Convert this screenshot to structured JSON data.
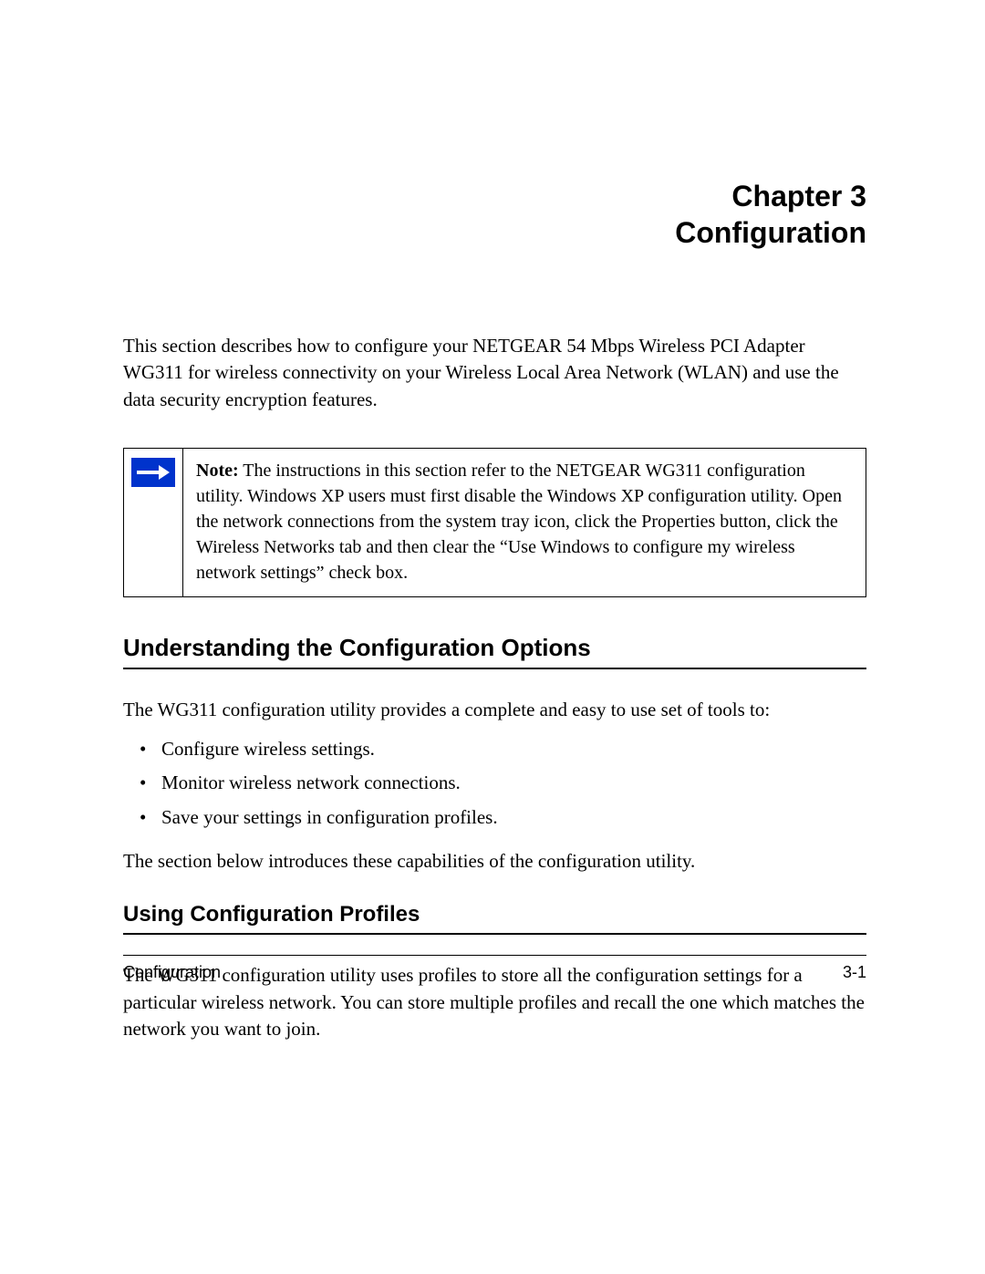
{
  "chapter": {
    "line1": "Chapter 3",
    "line2": "Configuration"
  },
  "intro": "This section describes how to configure your NETGEAR 54 Mbps Wireless PCI Adapter WG311 for wireless connectivity on your Wireless Local Area Network (WLAN) and use the data security encryption features.",
  "note": {
    "label": "Note:",
    "text": " The instructions in this section refer to the NETGEAR WG311 configuration utility. Windows XP users must first disable the Windows XP configuration utility. Open the network connections from the system tray icon, click the Properties button, click the Wireless Networks tab and then clear the “Use Windows to configure my wireless network settings” check box."
  },
  "section1": {
    "heading": "Understanding the Configuration Options",
    "intro": "The WG311 configuration utility provides a complete and easy to use set of tools to:",
    "bullets": [
      "Configure wireless settings.",
      "Monitor wireless network connections.",
      "Save your settings in configuration profiles."
    ],
    "outro": "The section below introduces these capabilities of the configuration utility."
  },
  "section2": {
    "heading": "Using Configuration Profiles",
    "body": "The WG311 configuration utility uses profiles to store all the configuration settings for a particular wireless network. You can store multiple profiles and recall the one which matches the network you want to join."
  },
  "footer": {
    "left": "Configuration",
    "right": "3-1"
  }
}
